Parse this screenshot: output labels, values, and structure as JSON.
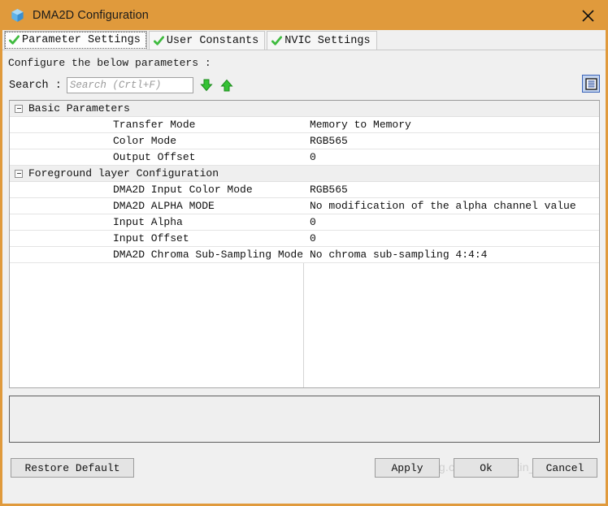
{
  "window": {
    "title": "DMA2D Configuration",
    "icon": "cube-icon",
    "close_label": "✕",
    "accent_color": "#e09a3c"
  },
  "tabs": [
    {
      "label": "Parameter Settings",
      "icon": "green-check-icon",
      "active": true
    },
    {
      "label": "User Constants",
      "icon": "green-check-icon",
      "active": false
    },
    {
      "label": "NVIC Settings",
      "icon": "green-check-icon",
      "active": false
    }
  ],
  "instruction": "Configure the below parameters :",
  "search": {
    "label": "Search :",
    "value": "",
    "placeholder": "Search (Crtl+F)",
    "next_icon": "arrow-down-icon",
    "prev_icon": "arrow-up-icon",
    "view_toggle_icon": "list-view-icon"
  },
  "tree": {
    "groups": [
      {
        "label": "Basic Parameters",
        "expanded": true,
        "rows": [
          {
            "name": "Transfer Mode",
            "value": "Memory to Memory"
          },
          {
            "name": "Color Mode",
            "value": "RGB565"
          },
          {
            "name": "Output Offset",
            "value": "0"
          }
        ]
      },
      {
        "label": "Foreground layer Configuration",
        "expanded": true,
        "rows": [
          {
            "name": "DMA2D Input Color Mode",
            "value": "RGB565"
          },
          {
            "name": "DMA2D ALPHA MODE",
            "value": "No modification of the alpha channel value"
          },
          {
            "name": "Input Alpha",
            "value": "0"
          },
          {
            "name": "Input Offset",
            "value": "0"
          },
          {
            "name": "DMA2D Chroma Sub-Sampling Mode",
            "value": "No chroma sub-sampling 4:4:4"
          }
        ]
      }
    ]
  },
  "description_panel": {
    "text": ""
  },
  "buttons": {
    "restore": "Restore Default",
    "apply": "Apply",
    "ok": "Ok",
    "cancel": "Cancel"
  },
  "watermark": "https://blog.csdn.net/weixin_47681134"
}
